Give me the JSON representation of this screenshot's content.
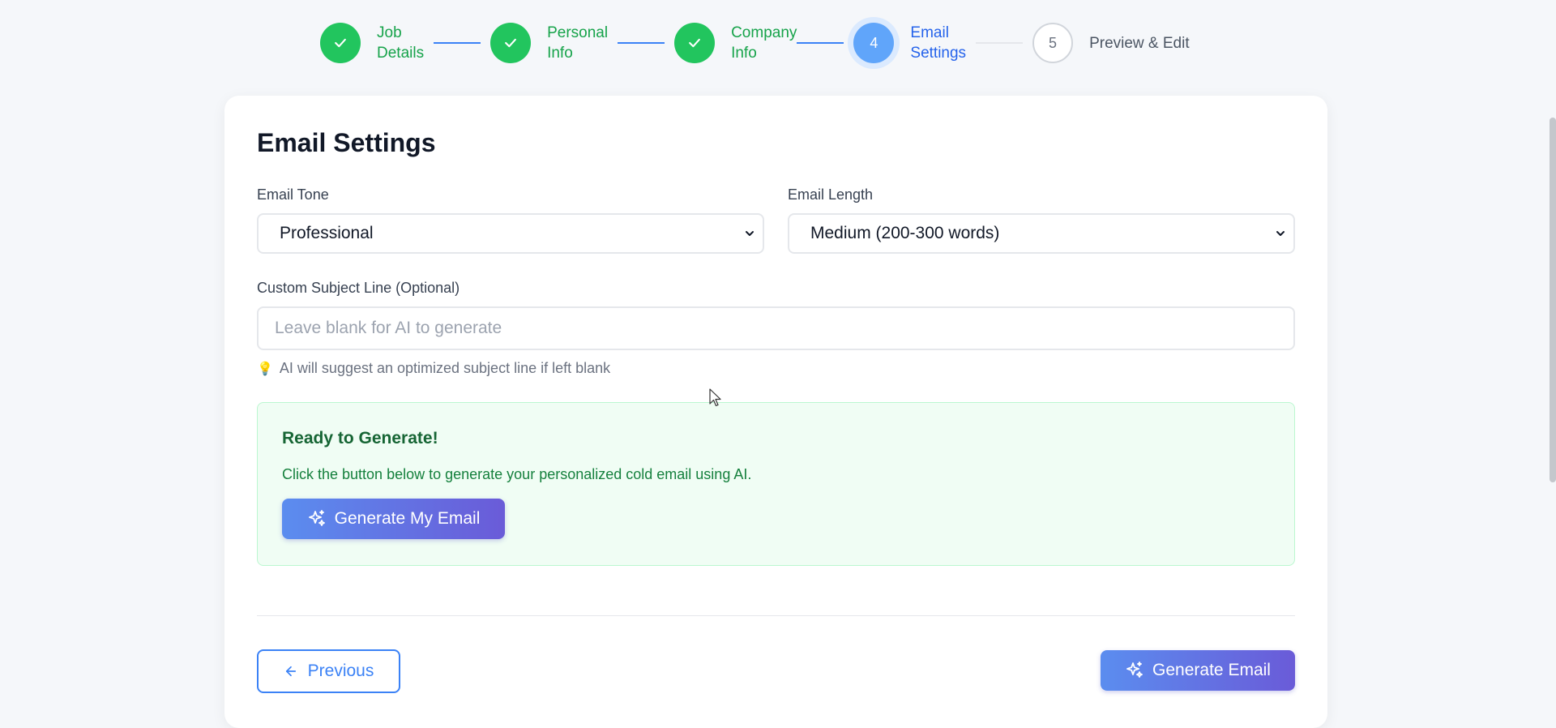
{
  "stepper": {
    "steps": [
      {
        "label_line1": "Job",
        "label_line2": "Details",
        "state": "done"
      },
      {
        "label_line1": "Personal",
        "label_line2": "Info",
        "state": "done"
      },
      {
        "label_line1": "Company",
        "label_line2": "Info",
        "state": "done"
      },
      {
        "number": "4",
        "label_line1": "Email",
        "label_line2": "Settings",
        "state": "active"
      },
      {
        "number": "5",
        "label_line1": "Preview & Edit",
        "label_line2": "",
        "state": "todo"
      }
    ]
  },
  "form": {
    "title": "Email Settings",
    "tone_label": "Email Tone",
    "tone_value": "Professional",
    "length_label": "Email Length",
    "length_value": "Medium (200-300 words)",
    "subject_label": "Custom Subject Line (Optional)",
    "subject_placeholder": "Leave blank for AI to generate",
    "subject_hint": "AI will suggest an optimized subject line if left blank"
  },
  "ready": {
    "title": "Ready to Generate!",
    "text": "Click the button below to generate your personalized cold email using AI.",
    "button": "Generate My Email"
  },
  "nav": {
    "previous": "Previous",
    "generate": "Generate Email"
  },
  "colors": {
    "done": "#22c55e",
    "active": "#60a5fa",
    "accent": "#3b82f6",
    "gradient_start": "#5b8def",
    "gradient_end": "#6a5bd8"
  }
}
